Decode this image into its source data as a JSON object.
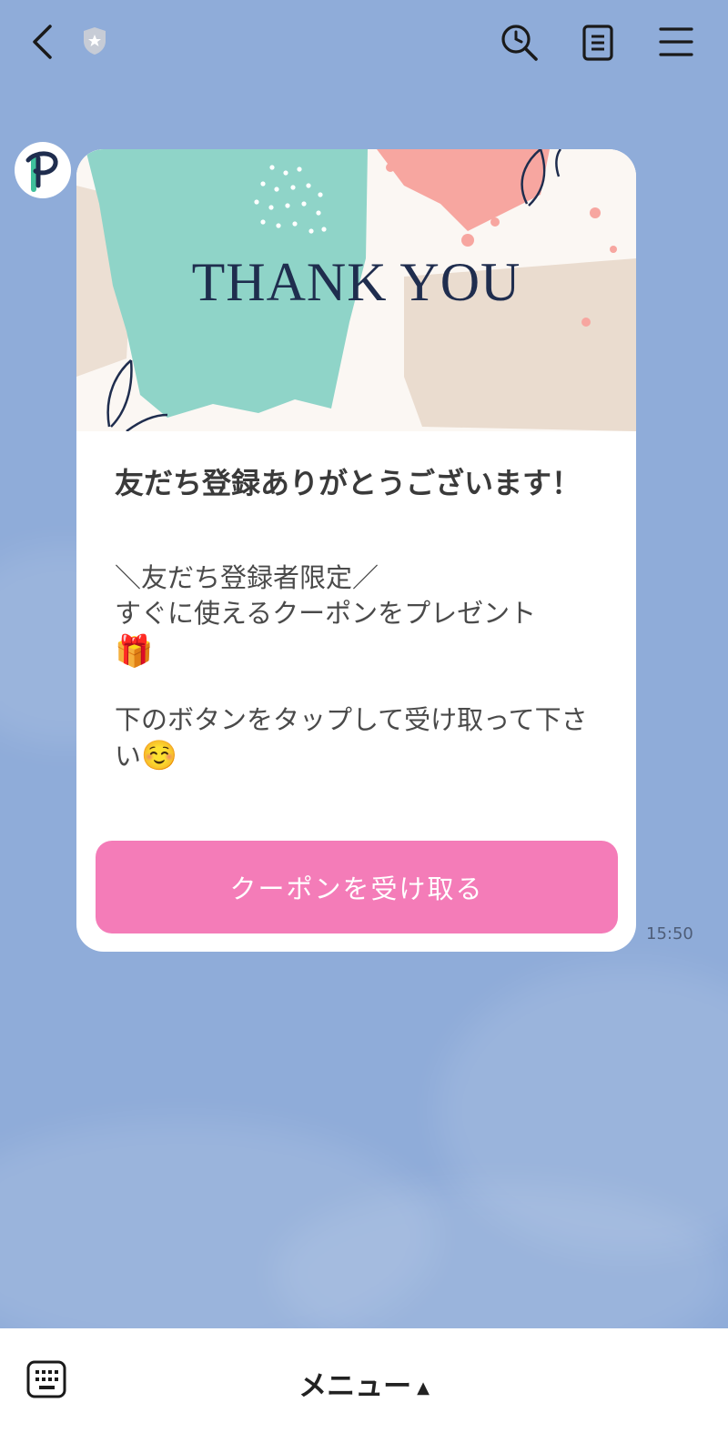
{
  "header": {
    "back_icon": "chevron-left-icon",
    "badge_icon": "shield-star-icon",
    "search_icon": "search-clock-icon",
    "notes_icon": "note-icon",
    "menu_icon": "hamburger-icon"
  },
  "message": {
    "sender_avatar_letter": "P",
    "banner_text": "THANK YOU",
    "heading": "友だち登録ありがとうございます！",
    "line1": "＼友だち登録者限定／",
    "line2": "すぐに使えるクーポンをプレゼント",
    "emoji1": "🎁",
    "line3": "下のボタンをタップして受け取って下さい",
    "emoji2": "☺️",
    "button_label": "クーポンを受け取る",
    "time": "15:50"
  },
  "footer": {
    "keyboard_icon": "keyboard-icon",
    "menu_label": "メニュー",
    "menu_caret": "▲"
  },
  "colors": {
    "background": "#8FACD9",
    "button": "#F47CB8",
    "banner_teal": "#8FD4C8",
    "banner_pink": "#F7A6A0",
    "banner_beige": "#EADCCF",
    "title_navy": "#1F2D4E"
  }
}
